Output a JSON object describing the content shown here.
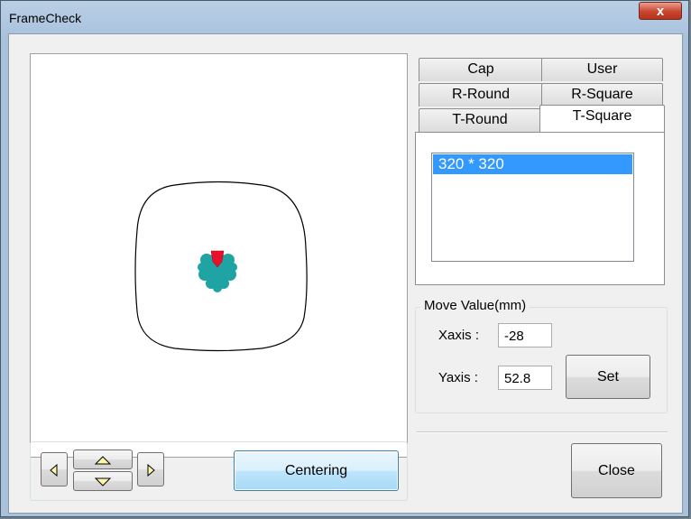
{
  "window": {
    "title": "FrameCheck",
    "close_glyph": "x"
  },
  "tabs": {
    "row1": [
      "Cap",
      "User"
    ],
    "row2": [
      "R-Round",
      "R-Square"
    ],
    "row3": [
      "T-Round",
      "T-Square"
    ],
    "active": "T-Square"
  },
  "frame_list": {
    "items": [
      "320 * 320"
    ],
    "selected": "320 * 320"
  },
  "move_value": {
    "title": "Move Value(mm)",
    "xaxis_label": "Xaxis :",
    "xaxis_value": "-28",
    "yaxis_label": "Yaxis :",
    "yaxis_value": "52.8",
    "set_label": "Set"
  },
  "buttons": {
    "centering_label": "Centering",
    "close_label": "Close",
    "left_icon": "triangle-left-icon",
    "up_icon": "triangle-up-icon",
    "down_icon": "triangle-down-icon",
    "right_icon": "triangle-right-icon"
  },
  "colors": {
    "selection": "#3399ff",
    "stitch_fill": "#1fa3a3",
    "needle_marker": "#e8102a"
  }
}
